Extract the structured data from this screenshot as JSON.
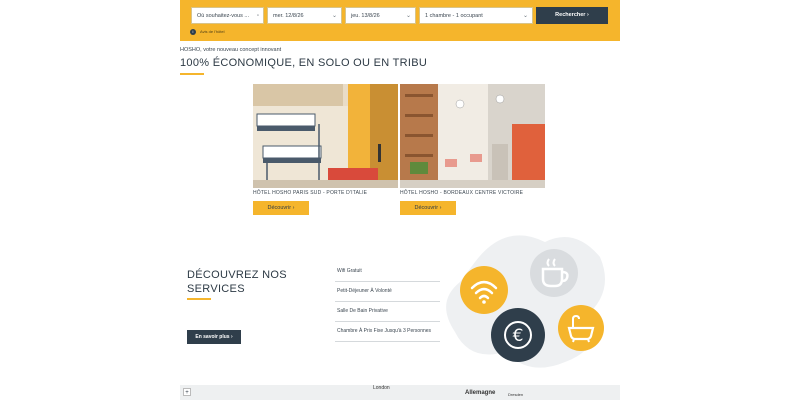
{
  "search": {
    "destination_placeholder": "Où souhaitez-vous ...",
    "checkin": "mer. 12/8/26",
    "checkout": "jeu. 13/8/26",
    "rooms": "1 chambre - 1 occupant",
    "submit_label": "Rechercher",
    "legal_text": "Avis de l'hôtel"
  },
  "intro": {
    "tagline": "HOSHO, votre nouveau concept innovant",
    "headline": "100% ÉCONOMIQUE, EN SOLO OU EN TRIBU"
  },
  "hotels": [
    {
      "caption": "HÔTEL HOSHO PARIS SUD - PORTE D'ITALIE",
      "button": "Découvrir"
    },
    {
      "caption": "HÔTEL HOSHO - BORDEAUX CENTRE VICTOIRE",
      "button": "Découvrir"
    }
  ],
  "services": {
    "title_line1": "DÉCOUVREZ NOS",
    "title_line2": "SERVICES",
    "button": "En savoir plus",
    "items": [
      "Wifi Gratuit",
      "Petit-Déjeuner À Volonté",
      "Salle De Bain Privative",
      "Chambre À Prix Fixe Jusqu'à 3 Personnes"
    ],
    "icons": [
      "wifi-icon",
      "coffee-cup-icon",
      "euro-icon",
      "bathtub-icon"
    ]
  },
  "map": {
    "zoom": "+",
    "labels": [
      "London",
      "Allemagne",
      "Dresden"
    ]
  },
  "colors": {
    "accent": "#f5b52c",
    "dark": "#2f3e4b",
    "light_circle": "#d9dcdf"
  }
}
